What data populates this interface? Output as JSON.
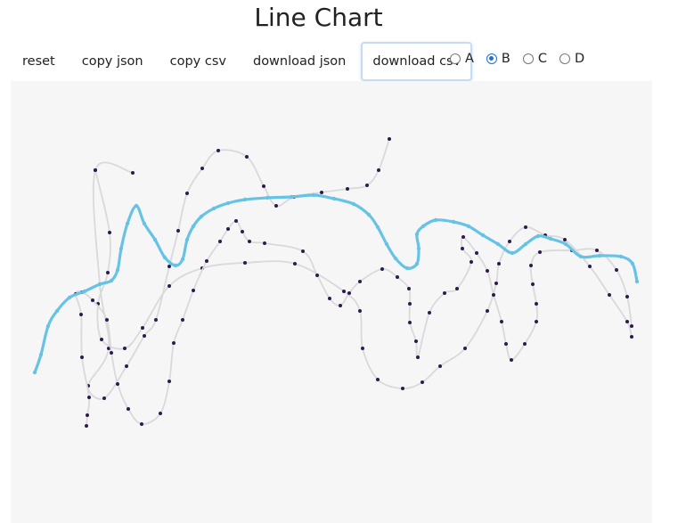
{
  "page": {
    "title": "Line Chart"
  },
  "toolbar": {
    "buttons": [
      {
        "id": "reset",
        "label": "reset"
      },
      {
        "id": "copy-json",
        "label": "copy json"
      },
      {
        "id": "copy-csv",
        "label": "copy csv"
      },
      {
        "id": "download-json",
        "label": "download json"
      },
      {
        "id": "download-csv",
        "label": "download csv"
      }
    ],
    "focused_button": "download csv"
  },
  "radio": {
    "options": [
      "A",
      "B",
      "C",
      "D"
    ],
    "selected": "B"
  },
  "colors": {
    "plot_background": "#f6f6f6",
    "gray_line": "#d9d9d9",
    "highlight_line": "#67c3e5",
    "points": "#2d1b4e"
  },
  "chart_data": {
    "type": "line",
    "title": "",
    "xlabel": "",
    "ylabel": "",
    "axes_visible": false,
    "grid": false,
    "highlighted_series": "B",
    "series": [
      {
        "name": "A",
        "points": [
          [
            137,
            103
          ],
          [
            95,
            100
          ],
          [
            100,
            228
          ],
          [
            110,
            300
          ],
          [
            87,
            342
          ],
          [
            105,
            356
          ],
          [
            130,
            320
          ],
          [
            150,
            286
          ],
          [
            163,
            268
          ],
          [
            178,
            208
          ],
          [
            188,
            168
          ],
          [
            198,
            126
          ],
          [
            215,
            98
          ],
          [
            233,
            78
          ],
          [
            265,
            85
          ],
          [
            284,
            118
          ],
          [
            298,
            140
          ],
          [
            318,
            130
          ],
          [
            349,
            125
          ],
          [
            378,
            121
          ],
          [
            400,
            117
          ],
          [
            413,
            100
          ],
          [
            425,
            65
          ]
        ]
      },
      {
        "name": "B",
        "points": [
          [
            27,
            327
          ],
          [
            34,
            307
          ],
          [
            42,
            275
          ],
          [
            52,
            258
          ],
          [
            66,
            243
          ],
          [
            83,
            236
          ],
          [
            100,
            228
          ],
          [
            113,
            224
          ],
          [
            120,
            212
          ],
          [
            124,
            188
          ],
          [
            131,
            160
          ],
          [
            141,
            140
          ],
          [
            150,
            160
          ],
          [
            162,
            178
          ],
          [
            173,
            198
          ],
          [
            185,
            207
          ],
          [
            193,
            200
          ],
          [
            198,
            178
          ],
          [
            205,
            163
          ],
          [
            214,
            152
          ],
          [
            228,
            143
          ],
          [
            244,
            137
          ],
          [
            263,
            133
          ],
          [
            288,
            131
          ],
          [
            315,
            130
          ],
          [
            340,
            128
          ],
          [
            363,
            132
          ],
          [
            385,
            138
          ],
          [
            402,
            150
          ],
          [
            412,
            164
          ],
          [
            422,
            183
          ],
          [
            432,
            199
          ],
          [
            445,
            210
          ],
          [
            456,
            205
          ],
          [
            458,
            188
          ],
          [
            456,
            172
          ],
          [
            463,
            163
          ],
          [
            477,
            156
          ],
          [
            497,
            158
          ],
          [
            514,
            163
          ],
          [
            530,
            173
          ],
          [
            547,
            183
          ],
          [
            563,
            193
          ],
          [
            578,
            183
          ],
          [
            592,
            174
          ],
          [
            606,
            177
          ],
          [
            623,
            183
          ],
          [
            640,
            197
          ],
          [
            661,
            196
          ],
          [
            685,
            197
          ],
          [
            698,
            205
          ],
          [
            703,
            225
          ]
        ]
      },
      {
        "name": "C",
        "points": [
          [
            95,
            100
          ],
          [
            111,
            170
          ],
          [
            109,
            215
          ],
          [
            98,
            250
          ],
          [
            102,
            290
          ],
          [
            128,
            300
          ],
          [
            148,
            277
          ],
          [
            178,
            230
          ],
          [
            215,
            210
          ],
          [
            263,
            204
          ],
          [
            319,
            205
          ],
          [
            374,
            236
          ],
          [
            392,
            258
          ],
          [
            395,
            300
          ],
          [
            412,
            335
          ],
          [
            440,
            345
          ],
          [
            462,
            338
          ],
          [
            482,
            320
          ],
          [
            510,
            300
          ],
          [
            535,
            258
          ],
          [
            545,
            227
          ],
          [
            548,
            205
          ],
          [
            560,
            180
          ],
          [
            578,
            164
          ],
          [
            600,
            173
          ],
          [
            622,
            178
          ],
          [
            650,
            208
          ],
          [
            672,
            240
          ],
          [
            692,
            270
          ],
          [
            697,
            287
          ]
        ]
      },
      {
        "name": "D",
        "points": [
          [
            85,
            387
          ],
          [
            86,
            375
          ],
          [
            88,
            355
          ],
          [
            80,
            310
          ],
          [
            79,
            262
          ],
          [
            73,
            239
          ],
          [
            80,
            237
          ],
          [
            92,
            246
          ],
          [
            108,
            268
          ],
          [
            113,
            305
          ],
          [
            120,
            340
          ],
          [
            132,
            368
          ],
          [
            147,
            385
          ],
          [
            168,
            373
          ],
          [
            178,
            337
          ],
          [
            183,
            294
          ],
          [
            193,
            268
          ],
          [
            205,
            235
          ],
          [
            220,
            202
          ],
          [
            235,
            180
          ],
          [
            244,
            166
          ],
          [
            253,
            157
          ],
          [
            260,
            169
          ],
          [
            268,
            180
          ],
          [
            285,
            182
          ],
          [
            328,
            191
          ],
          [
            344,
            218
          ],
          [
            358,
            244
          ],
          [
            370,
            252
          ],
          [
            380,
            238
          ],
          [
            392,
            225
          ],
          [
            417,
            211
          ],
          [
            434,
            220
          ],
          [
            447,
            233
          ],
          [
            448,
            250
          ],
          [
            448,
            271
          ],
          [
            455,
            292
          ],
          [
            457,
            310
          ],
          [
            470,
            260
          ],
          [
            487,
            238
          ],
          [
            501,
            233
          ],
          [
            517,
            203
          ],
          [
            507,
            188
          ],
          [
            508,
            175
          ],
          [
            523,
            193
          ],
          [
            535,
            213
          ],
          [
            542,
            240
          ],
          [
            551,
            270
          ],
          [
            556,
            295
          ],
          [
            562,
            313
          ],
          [
            577,
            295
          ],
          [
            590,
            270
          ],
          [
            590,
            250
          ],
          [
            586,
            228
          ],
          [
            584,
            207
          ],
          [
            594,
            192
          ],
          [
            630,
            190
          ],
          [
            658,
            190
          ],
          [
            680,
            212
          ],
          [
            692,
            242
          ],
          [
            697,
            275
          ]
        ]
      }
    ]
  }
}
